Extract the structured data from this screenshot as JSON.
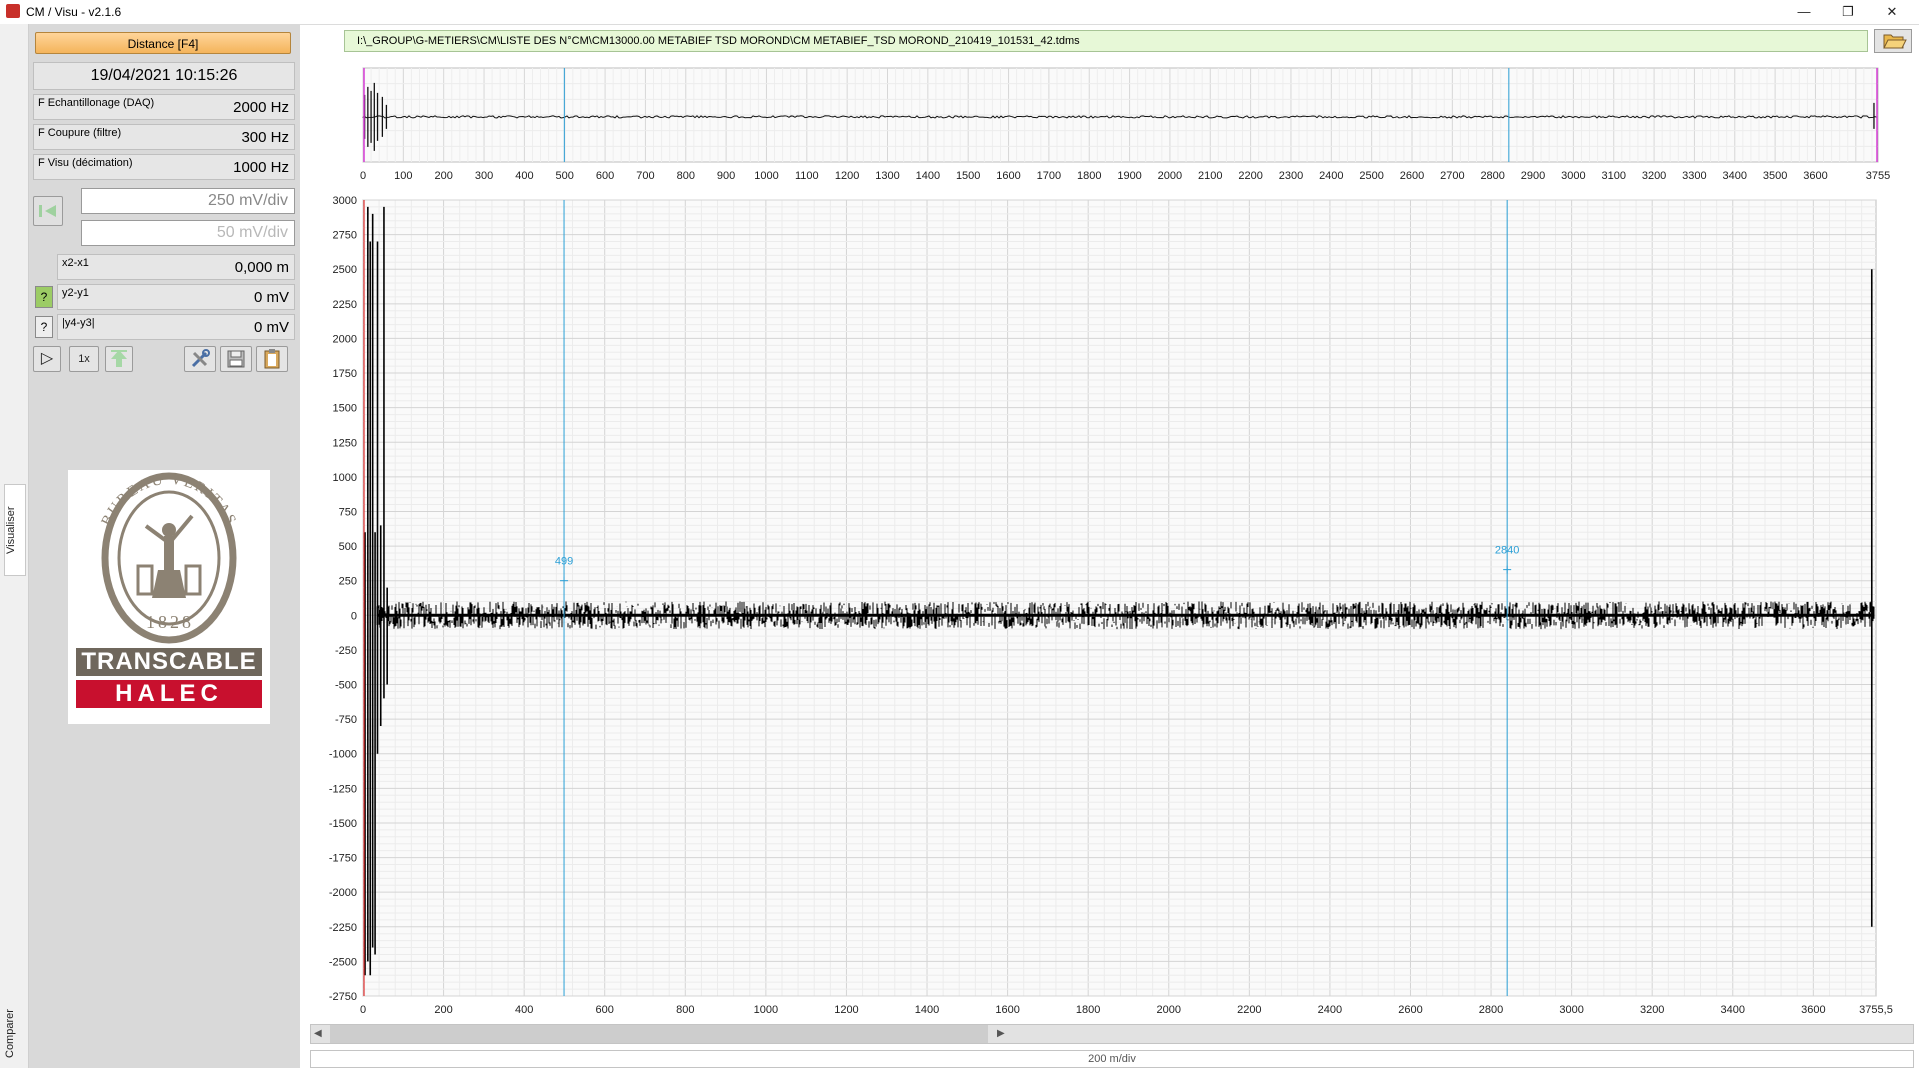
{
  "window": {
    "title": "CM / Visu - v2.1.6",
    "minimize": "—",
    "restore": "❐",
    "close": "✕"
  },
  "side_tabs": {
    "visualiser": "Visualiser",
    "comparer": "Comparer"
  },
  "panel": {
    "distance_button": "Distance [F4]",
    "datetime": "19/04/2021 10:15:26",
    "fields": [
      {
        "label": "F Echantillonage (DAQ)",
        "value": "2000 Hz"
      },
      {
        "label": "F Coupure (filtre)",
        "value": "300 Hz"
      },
      {
        "label": "F Visu (décimation)",
        "value": "1000 Hz"
      }
    ],
    "mv_div_1": "250 mV/div",
    "mv_div_2": "50 mV/div",
    "measures": [
      {
        "label": "x2-x1",
        "value": "0,000 m"
      },
      {
        "label": "y2-y1",
        "value": "0 mV"
      },
      {
        "label": "|y4-y3|",
        "value": "0 mV"
      }
    ],
    "help_glyph": "?",
    "play_glyph": "▷",
    "speed_label": "1x"
  },
  "logo": {
    "ring_text": "BUREAU VERITAS",
    "year": "1828",
    "brand_line1": "TRANSCABLE",
    "brand_line2": "HALEC",
    "colors": {
      "seal": "#8c8273",
      "brand_dark": "#6f675c",
      "brand_red": "#c8102e"
    }
  },
  "file_path": "I:\\_GROUP\\G-METIERS\\CM\\LISTE DES N°CM\\CM13000.00 METABIEF TSD MOROND\\CM METABIEF_TSD MOROND_210419_101531_42.tdms",
  "icons": [
    "folder-open-icon",
    "back-arrow-icon",
    "play-icon",
    "upload-arrow-icon",
    "tools-icon",
    "save-disk-icon",
    "clipboard-icon",
    "help-icon"
  ],
  "chart_data": [
    {
      "type": "line",
      "name": "overview",
      "xlim": [
        0,
        3755
      ],
      "x_ticks": [
        0,
        100,
        200,
        300,
        400,
        500,
        600,
        700,
        800,
        900,
        1000,
        1100,
        1200,
        1300,
        1400,
        1500,
        1600,
        1700,
        1800,
        1900,
        2000,
        2100,
        2200,
        2300,
        2400,
        2500,
        2600,
        2700,
        2800,
        2900,
        3000,
        3100,
        3200,
        3300,
        3400,
        3500,
        3600,
        3755
      ],
      "cursors": [
        499,
        2840
      ],
      "grid": true
    },
    {
      "type": "line",
      "name": "main",
      "xlim": [
        0,
        3755.5
      ],
      "ylim": [
        -2750,
        3000
      ],
      "x_ticks": [
        0,
        200,
        400,
        600,
        800,
        1000,
        1200,
        1400,
        1600,
        1800,
        2000,
        2200,
        2400,
        2600,
        2800,
        3000,
        3200,
        3400,
        3600
      ],
      "x_end_label": "3755,5",
      "y_ticks": [
        3000,
        2750,
        2500,
        2250,
        2000,
        1750,
        1500,
        1250,
        1000,
        750,
        500,
        250,
        0,
        -250,
        -500,
        -750,
        -1000,
        -1250,
        -1500,
        -1750,
        -2000,
        -2250,
        -2500,
        -2750
      ],
      "cursors": [
        {
          "x": 499,
          "label": "499",
          "y": 250
        },
        {
          "x": 2840,
          "label": "2840",
          "y": 330
        }
      ],
      "spikes": [
        {
          "x": 5,
          "y_min": -2600,
          "y_max": 600
        },
        {
          "x": 12,
          "y_min": -2500,
          "y_max": 2950
        },
        {
          "x": 18,
          "y_min": -2600,
          "y_max": 2700
        },
        {
          "x": 24,
          "y_min": -2400,
          "y_max": 2900
        },
        {
          "x": 30,
          "y_min": -2450,
          "y_max": 600
        },
        {
          "x": 36,
          "y_min": -1000,
          "y_max": 2700
        },
        {
          "x": 44,
          "y_min": -800,
          "y_max": 650
        },
        {
          "x": 52,
          "y_min": -600,
          "y_max": 2950
        },
        {
          "x": 60,
          "y_min": -500,
          "y_max": 200
        },
        {
          "x": 3745,
          "y_min": -2250,
          "y_max": 2500
        }
      ],
      "noise_band": [
        -100,
        100
      ],
      "grid": true,
      "colors": {
        "trace": "#000000",
        "cursor": "#2a9fd6",
        "grid_major": "#d4d4d4",
        "grid_minor": "#ececec"
      }
    }
  ],
  "status": "200 m/div"
}
